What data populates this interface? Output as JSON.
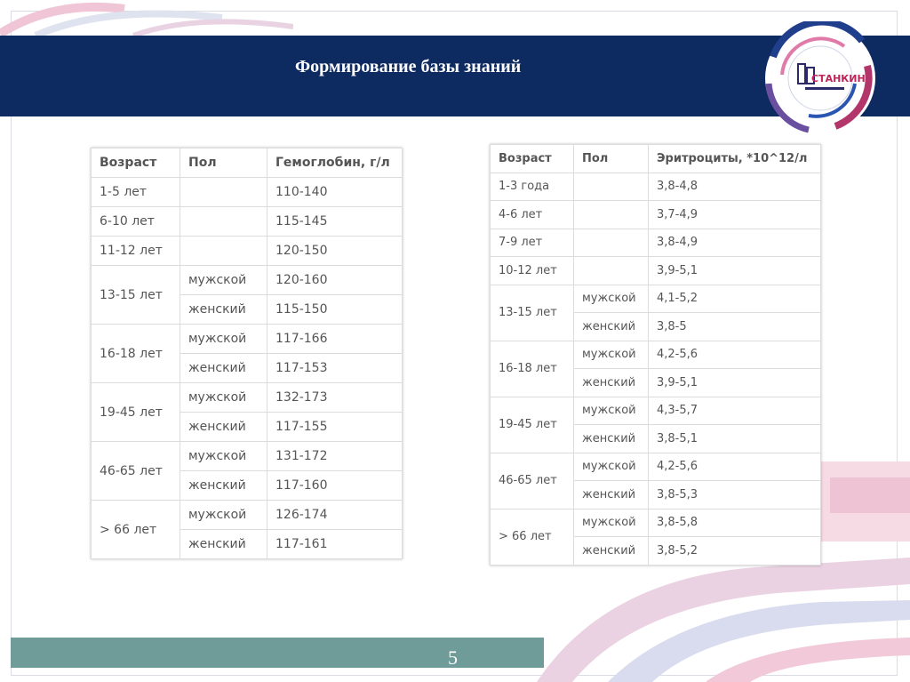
{
  "header": {
    "title": "Формирование базы знаний"
  },
  "logo": {
    "text": "СТАНКИН"
  },
  "footer": {
    "page_number": "5"
  },
  "hemoglobin_table": {
    "columns": [
      "Возраст",
      "Пол",
      "Гемоглобин, г/л"
    ],
    "rows": [
      {
        "age": "1-5 лет",
        "sex": "",
        "value": "110-140"
      },
      {
        "age": "6-10 лет",
        "sex": "",
        "value": "115-145"
      },
      {
        "age": "11-12 лет",
        "sex": "",
        "value": "120-150"
      },
      {
        "age": "13-15 лет",
        "sex": "мужской",
        "value": "120-160"
      },
      {
        "age": "",
        "sex": "женский",
        "value": "115-150"
      },
      {
        "age": "16-18 лет",
        "sex": "мужской",
        "value": "117-166"
      },
      {
        "age": "",
        "sex": "женский",
        "value": "117-153"
      },
      {
        "age": "19-45 лет",
        "sex": "мужской",
        "value": "132-173"
      },
      {
        "age": "",
        "sex": "женский",
        "value": "117-155"
      },
      {
        "age": "46-65 лет",
        "sex": "мужской",
        "value": "131-172"
      },
      {
        "age": "",
        "sex": "женский",
        "value": "117-160"
      },
      {
        "age": "> 66 лет",
        "sex": "мужской",
        "value": "126-174"
      },
      {
        "age": "",
        "sex": "женский",
        "value": "117-161"
      }
    ]
  },
  "erythrocyte_table": {
    "columns": [
      "Возраст",
      "Пол",
      "Эритроциты, *10^12/л"
    ],
    "rows": [
      {
        "age": "1-3 года",
        "sex": "",
        "value": "3,8-4,8"
      },
      {
        "age": "4-6 лет",
        "sex": "",
        "value": "3,7-4,9"
      },
      {
        "age": "7-9 лет",
        "sex": "",
        "value": "3,8-4,9"
      },
      {
        "age": "10-12 лет",
        "sex": "",
        "value": "3,9-5,1"
      },
      {
        "age": "13-15 лет",
        "sex": "мужской",
        "value": "4,1-5,2"
      },
      {
        "age": "",
        "sex": "женский",
        "value": "3,8-5"
      },
      {
        "age": "16-18 лет",
        "sex": "мужской",
        "value": "4,2-5,6"
      },
      {
        "age": "",
        "sex": "женский",
        "value": "3,9-5,1"
      },
      {
        "age": "19-45 лет",
        "sex": "мужской",
        "value": "4,3-5,7"
      },
      {
        "age": "",
        "sex": "женский",
        "value": "3,8-5,1"
      },
      {
        "age": "46-65 лет",
        "sex": "мужской",
        "value": "4,2-5,6"
      },
      {
        "age": "",
        "sex": "женский",
        "value": "3,8-5,3"
      },
      {
        "age": "> 66 лет",
        "sex": "мужской",
        "value": "3,8-5,8"
      },
      {
        "age": "",
        "sex": "женский",
        "value": "3,8-5,2"
      }
    ]
  }
}
